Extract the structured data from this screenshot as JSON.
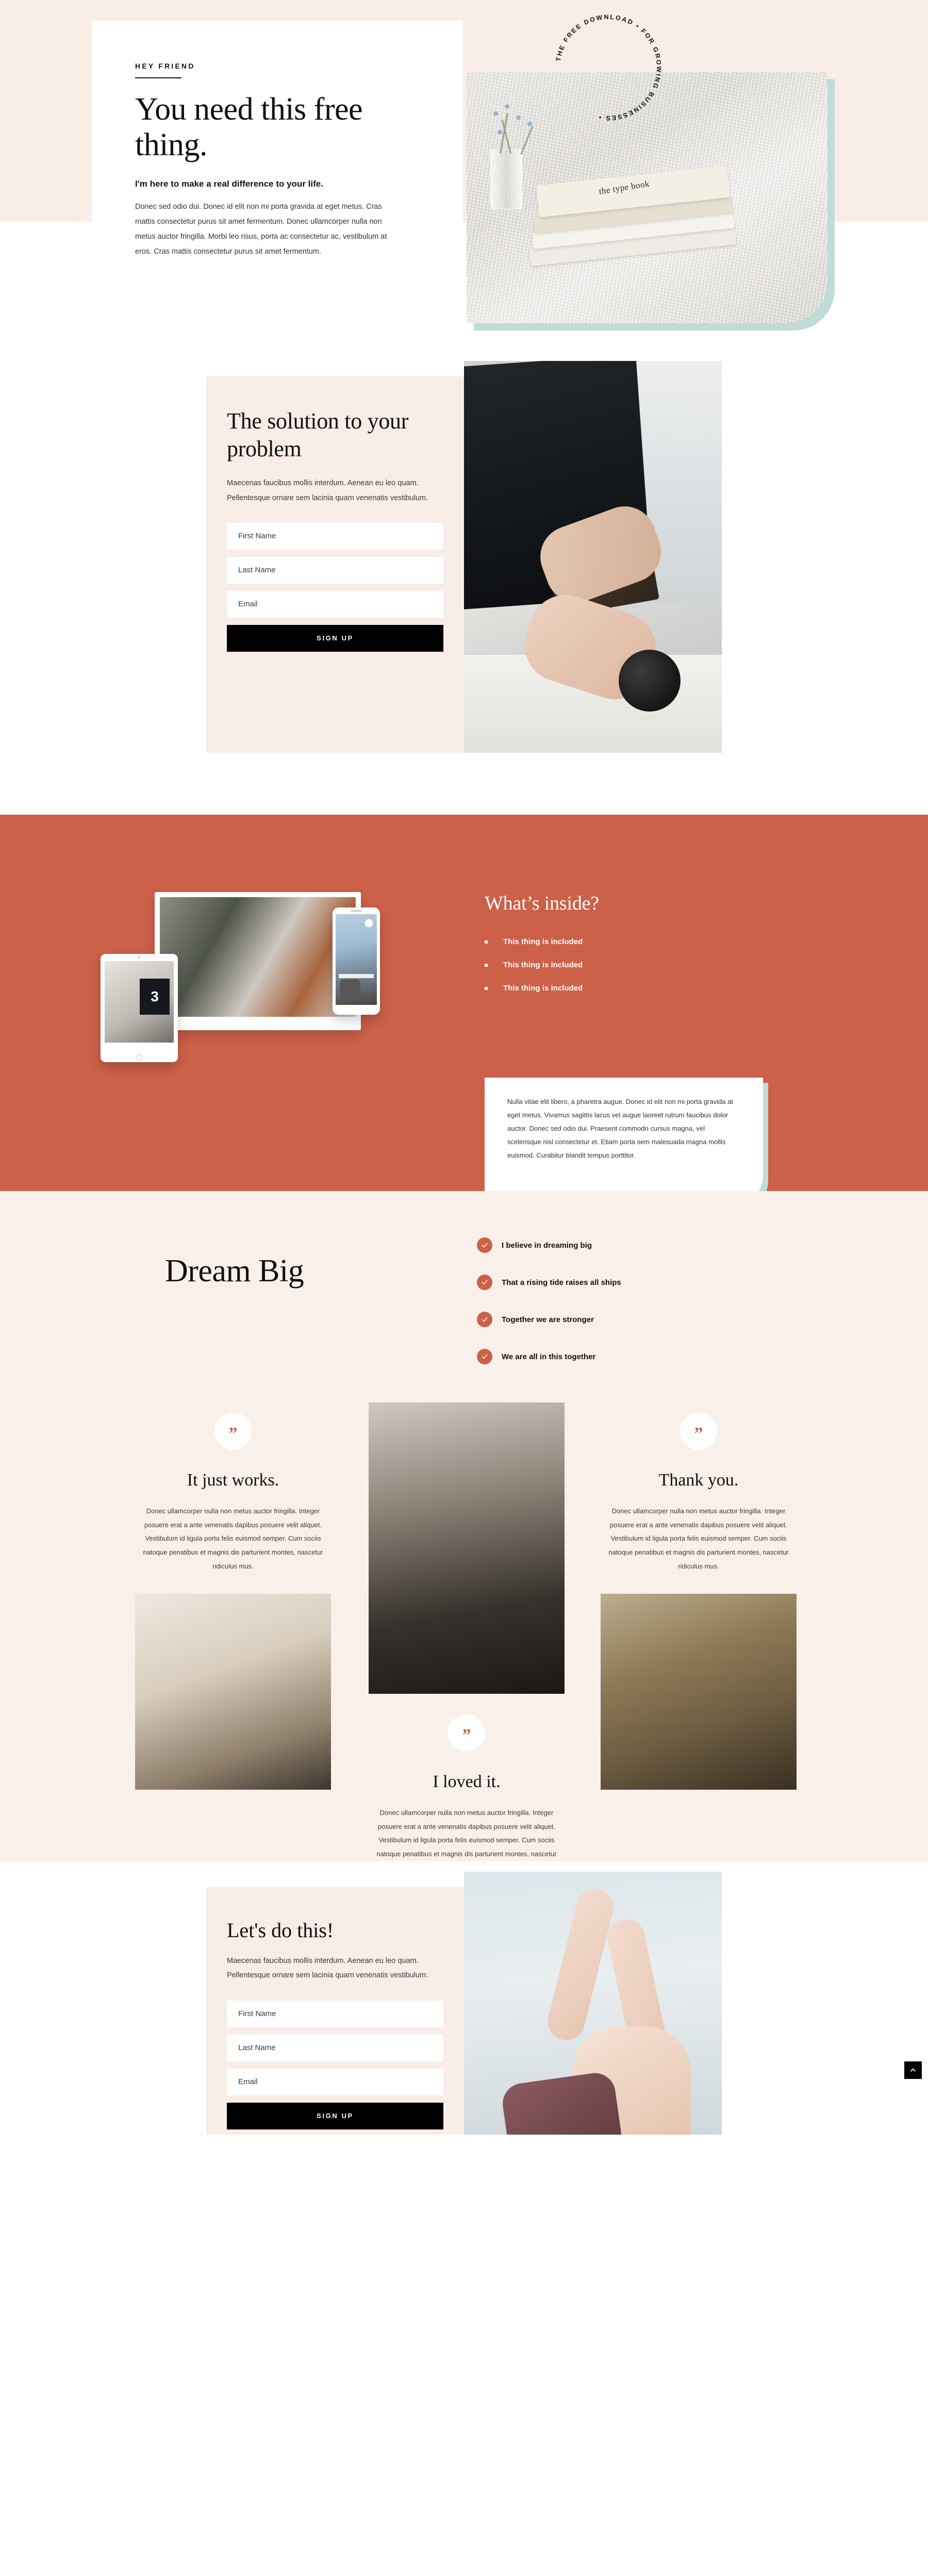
{
  "colors": {
    "cream": "#F8EDE7",
    "orange": "#CC6049",
    "teal": "#BFDCD8",
    "ink": "#111111",
    "white": "#FFFFFF"
  },
  "hero": {
    "eyebrow": "HEY FRIEND",
    "heading": "You need this free thing.",
    "lead": "I'm here to make a real difference to your life.",
    "body": "Donec sed odio dui. Donec id elit non mi porta gravida at eget metus. Cras mattis consectetur purus sit amet fermentum. Donec ullamcorper nulla non metus auctor fringilla. Morbi leo risus, porta ac consectetur ac, vestibulum at eros. Cras mattis consectetur purus sit amet fermentum.",
    "badge_text": "THE FREE DOWNLOAD • FOR GROWING BUSINESSES •",
    "photo_alt": "the type book"
  },
  "solution": {
    "heading": "The solution to your problem",
    "subtext": "Maecenas faucibus mollis interdum. Aenean eu leo quam. Pellentesque ornare sem lacinia quam venenatis vestibulum.",
    "form": {
      "first_name_placeholder": "First Name",
      "first_name_value": "",
      "last_name_placeholder": "Last Name",
      "last_name_value": "",
      "email_placeholder": "Email",
      "email_value": "",
      "submit_label": "SIGN UP"
    }
  },
  "inside": {
    "heading": "What’s inside?",
    "items": [
      "This thing is included",
      "This thing is included",
      "This thing is included"
    ],
    "quote_card": "Nulla vitae elit libero, a pharetra augue. Donec id elit non mi porta gravida at eget metus. Vivamus sagittis lacus vel augue laoreet rutrum faucibus dolor auctor. Donec sed odio dui. Praesent commodo cursus magna, vel scelerisque nisl consectetur et. Etiam porta sem malesuada magna mollis euismod. Curabitur blandit tempus porttitor.",
    "tablet_number": "3"
  },
  "dream": {
    "heading": "Dream Big",
    "beliefs": [
      "I believe in dreaming big",
      "That a rising tide raises all ships",
      "Together we are stronger",
      "We are all in this together"
    ]
  },
  "testimonials": {
    "quote_glyph": "”",
    "items": [
      {
        "title": "It just works.",
        "body": "Donec ullamcorper nulla non metus auctor fringilla. Integer posuere erat a ante venenatis dapibus posuere velit aliquet. Vestibulum id ligula porta felis euismod semper. Cum sociis natoque penatibus et magnis dis parturient montes, nascetur ridiculus mus."
      },
      {
        "title": "I loved it.",
        "body": "Donec ullamcorper nulla non metus auctor fringilla. Integer posuere erat a ante venenatis dapibus posuere velit aliquet. Vestibulum id ligula porta felis euismod semper. Cum sociis natoque penatibus et magnis dis parturient montes, nascetur ridiculus mus."
      },
      {
        "title": "Thank you.",
        "body": "Donec ullamcorper nulla non metus auctor fringilla. Integer posuere erat a ante venenatis dapibus posuere velit aliquet. Vestibulum id ligula porta felis euismod semper. Cum sociis natoque penatibus et magnis dis parturient montes, nascetur ridiculus mus."
      }
    ]
  },
  "final": {
    "heading": "Let's do this!",
    "subtext": "Maecenas faucibus mollis interdum. Aenean eu leo quam. Pellentesque ornare sem lacinia quam venenatis vestibulum.",
    "form": {
      "first_name_placeholder": "First Name",
      "first_name_value": "",
      "last_name_placeholder": "Last Name",
      "last_name_value": "",
      "email_placeholder": "Email",
      "email_value": "",
      "submit_label": "SIGN UP"
    }
  },
  "scroll_top": {
    "icon": "chevron-up-icon"
  }
}
